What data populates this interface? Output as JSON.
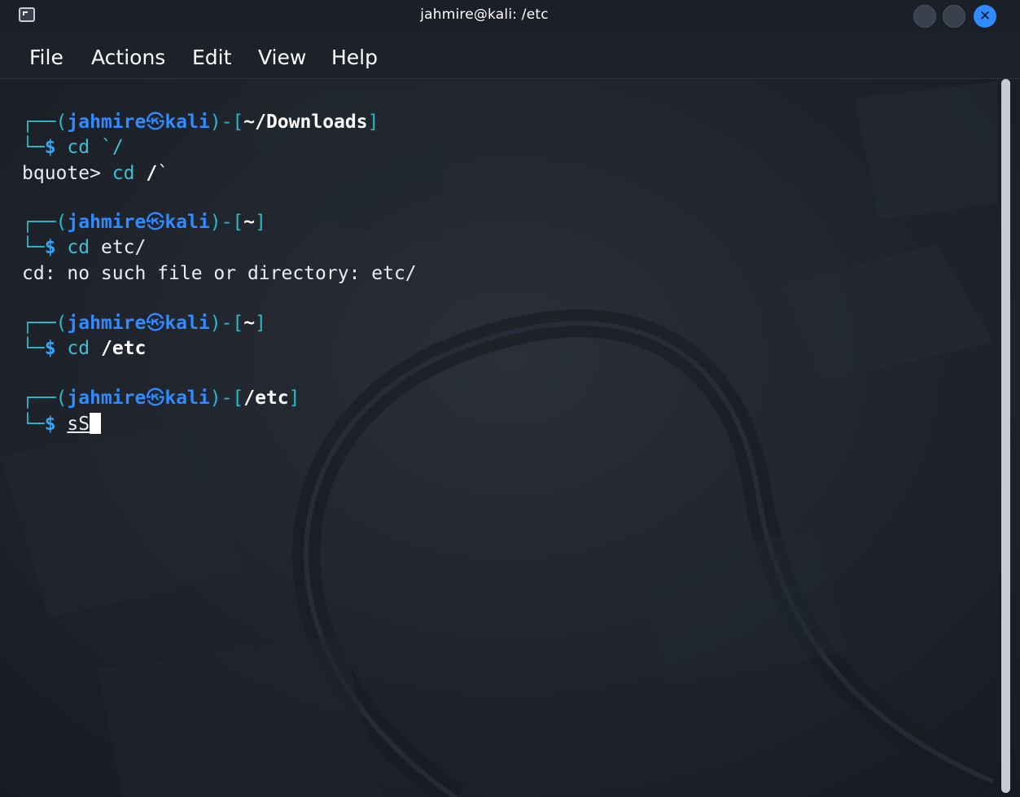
{
  "window": {
    "title": "jahmire@kali: /etc",
    "icons": {
      "app": "terminal-icon",
      "minimize": "minimize-icon",
      "maximize": "maximize-icon",
      "close": "close-icon"
    },
    "close_glyph": "✕"
  },
  "menu": {
    "file": "File",
    "actions": "Actions",
    "edit": "Edit",
    "view": "View",
    "help": "Help"
  },
  "terminal": {
    "prompt_top_left": "┌──(",
    "prompt_bottom_left": "└─",
    "prompt_sep": ")-[",
    "prompt_close": "]",
    "user": "jahmire",
    "skull": "㉿",
    "host": "kali",
    "dollar": "$",
    "blocks": [
      {
        "path": "~/Downloads",
        "command": "cd",
        "args": "`/"
      },
      {
        "path": "~",
        "command": "cd",
        "args": "etc/"
      },
      {
        "path": "~",
        "command": "cd",
        "args": "/etc"
      },
      {
        "path": "/etc",
        "typed": "sS"
      }
    ],
    "bquote_prefix": "bquote> ",
    "bquote_cmd": "cd",
    "bquote_arg": "/",
    "bquote_tail": "`",
    "error_line": "cd: no such file or directory: etc/"
  },
  "colors": {
    "accent_blue": "#2f8bff",
    "frame_cyan": "#2db8c8",
    "background": "#1e232c"
  }
}
